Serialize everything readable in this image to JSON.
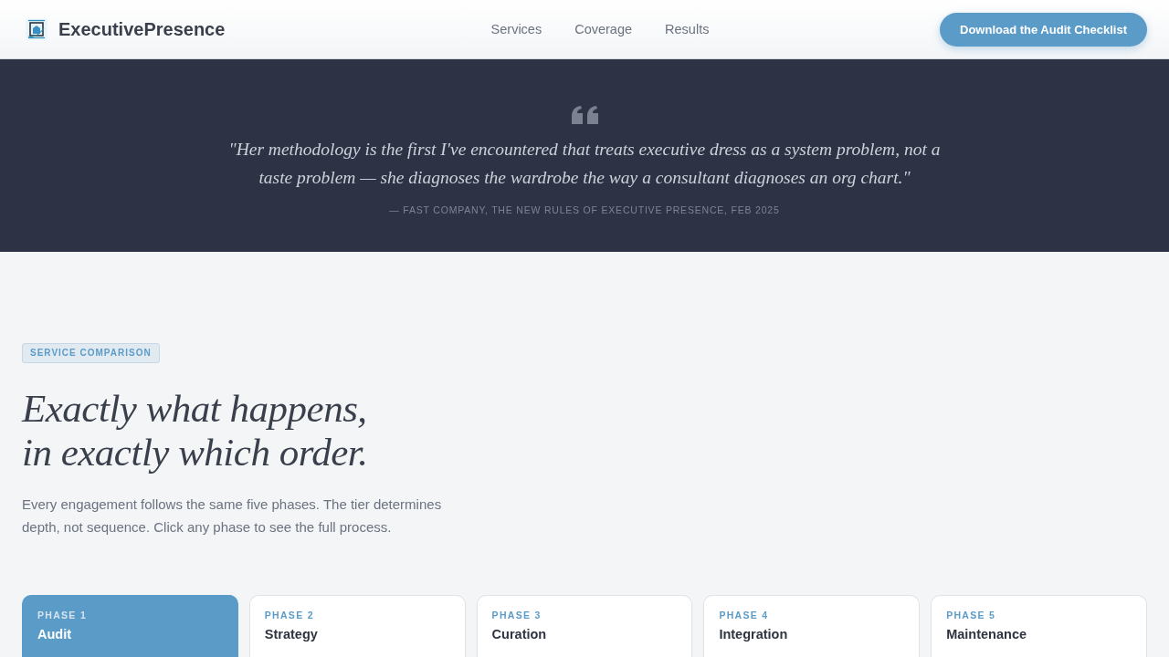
{
  "header": {
    "brand": "ExecutivePresence",
    "nav": [
      {
        "label": "Services"
      },
      {
        "label": "Coverage"
      },
      {
        "label": "Results"
      }
    ],
    "cta": "Download the Audit Checklist"
  },
  "quote": {
    "text": "\"Her methodology is the first I've encountered that treats executive dress as a system problem, not a taste problem — she diagnoses the wardrobe the way a consultant diagnoses an org chart.\"",
    "attribution": "— FAST COMPANY, THE NEW RULES OF EXECUTIVE PRESENCE, FEB 2025"
  },
  "comparison": {
    "badge": "SERVICE COMPARISON",
    "heading": [
      "Exactly what happens,",
      "in exactly which order."
    ],
    "intro": "Every engagement follows the same five phases. The tier determines depth, not sequence. Click any phase to see the full process.",
    "phases": [
      {
        "label": "PHASE 1",
        "title": "Audit",
        "selected": true
      },
      {
        "label": "PHASE 2",
        "title": "Strategy",
        "selected": false
      },
      {
        "label": "PHASE 3",
        "title": "Curation",
        "selected": false
      },
      {
        "label": "PHASE 4",
        "title": "Integration",
        "selected": false
      },
      {
        "label": "PHASE 5",
        "title": "Maintenance",
        "selected": false
      }
    ]
  }
}
